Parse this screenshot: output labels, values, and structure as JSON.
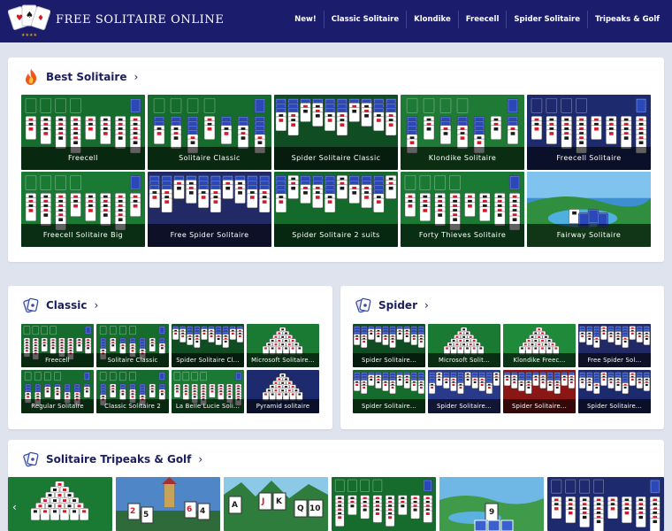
{
  "header": {
    "brand": "FREE SOLITAIRE ONLINE",
    "nav": [
      "New!",
      "Classic Solitaire",
      "Klondike",
      "Freecell",
      "Spider Solitaire",
      "Tripeaks & Golf"
    ]
  },
  "sections": {
    "best": {
      "title": "Best Solitaire",
      "arrow": "›",
      "games": [
        "Freecell",
        "Solitaire Classic",
        "Spider Solitaire Classic",
        "Klondike Solitaire",
        "Freecell Solitaire",
        "Freecell Solitaire Big",
        "Free Spider Solitaire",
        "Spider Solitaire 2 suits",
        "Forty Thieves Solitaire",
        "Fairway Solitaire"
      ]
    },
    "classic": {
      "title": "Classic",
      "arrow": "›",
      "games": [
        "Freecell",
        "Solitaire Classic",
        "Spider Solitaire Cl...",
        "Microsoft Solitaire...",
        "Regular Solitaire",
        "Classic Solitaire 2",
        "La Belle Lucie Soli...",
        "Pyramid solitaire"
      ]
    },
    "spider": {
      "title": "Spider",
      "arrow": "›",
      "games": [
        "Spider Solitaire...",
        "Microsoft Solit...",
        "Klondike Freec...",
        "Free Spider Sol...",
        "Spider Solitaire...",
        "Spider Solitaire...",
        "Spider Solitaire...",
        "Spider Solitaire..."
      ]
    },
    "tripeaks": {
      "title": "Solitaire Tripeaks & Golf",
      "arrow": "›",
      "card_labels": [
        "2",
        "5",
        "6",
        "4",
        "A",
        "J",
        "K",
        "Q",
        "10",
        "9"
      ]
    }
  },
  "carousel": {
    "prev": "‹",
    "next": "›"
  },
  "colors": {
    "header": "#1b1d6c",
    "background": "#dfe3ee",
    "felt_green": "#166c2c",
    "felt_blue": "#1d2b6e",
    "caption": "#ffffff"
  },
  "icons": {
    "logo": "playing-cards-logo",
    "best": "flame-icon",
    "classic": "cards-icon",
    "spider": "cards-icon",
    "tripeaks": "cards-icon"
  }
}
